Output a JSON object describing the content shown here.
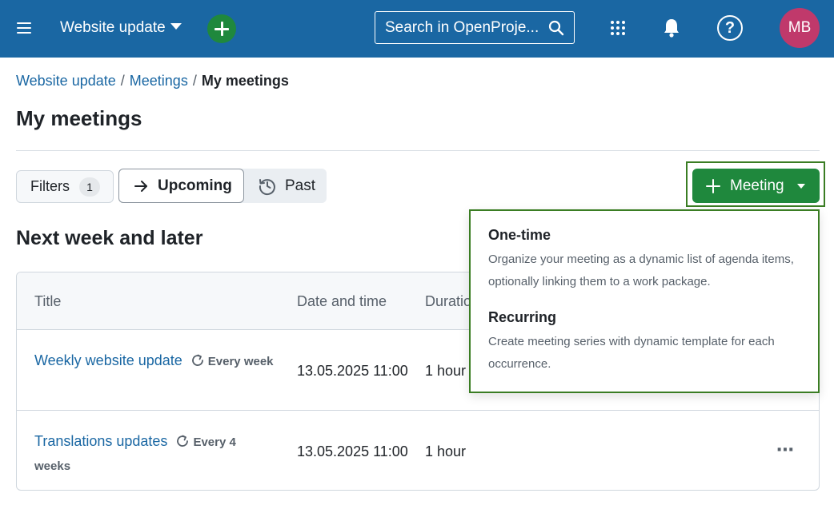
{
  "header": {
    "project_name": "Website update",
    "search_placeholder": "Search in OpenProje...",
    "avatar_initials": "MB",
    "help_label": "?",
    "bg_color": "#1a67a3"
  },
  "breadcrumb": {
    "items": [
      "Website update",
      "Meetings",
      "My meetings"
    ],
    "separator": "/"
  },
  "page": {
    "title": "My meetings"
  },
  "toolbar": {
    "filters_label": "Filters",
    "filters_count": "1",
    "upcoming_label": "Upcoming",
    "past_label": "Past",
    "meeting_button_label": "Meeting",
    "accent_color": "#1f883d"
  },
  "section": {
    "heading": "Next week and later"
  },
  "table": {
    "columns": [
      "Title",
      "Date and time",
      "Duration"
    ],
    "rows": [
      {
        "title": "Weekly website update",
        "recurrence": "Every week",
        "datetime": "13.05.2025 11:00",
        "duration": "1 hour"
      },
      {
        "title": "Translations updates",
        "recurrence": "Every 4 weeks",
        "datetime": "13.05.2025 11:00",
        "duration": "1 hour",
        "menu": "⋯"
      }
    ]
  },
  "dropdown": {
    "items": [
      {
        "title": "One-time",
        "description": "Organize your meeting as a dynamic list of agenda items, optionally linking them to a work package."
      },
      {
        "title": "Recurring",
        "description": "Create meeting series with dynamic template for each occurrence."
      }
    ]
  }
}
